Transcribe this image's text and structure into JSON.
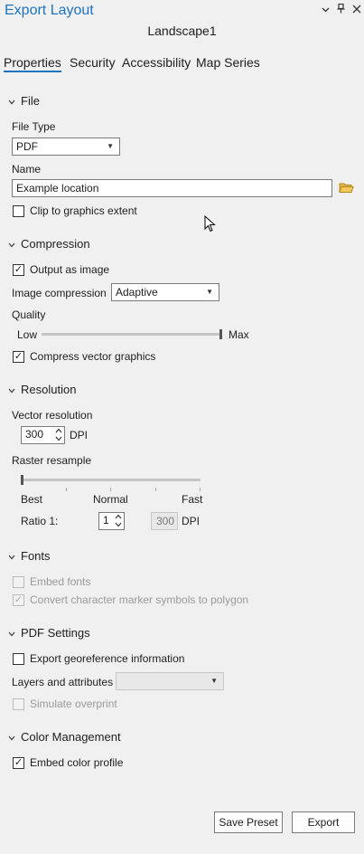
{
  "header": {
    "title": "Export Layout",
    "subtitle": "Landscape1",
    "controls": {
      "menu": "⌄",
      "pin": "📌",
      "close": "✕"
    }
  },
  "tabs": [
    {
      "label": "Properties",
      "active": true
    },
    {
      "label": "Security"
    },
    {
      "label": "Accessibility"
    },
    {
      "label": "Map Series"
    }
  ],
  "file": {
    "heading": "File",
    "file_type_label": "File Type",
    "file_type_value": "PDF",
    "name_label": "Name",
    "name_value": "Example location",
    "clip_label": "Clip to graphics extent",
    "clip_checked": false
  },
  "compression": {
    "heading": "Compression",
    "output_image_label": "Output as image",
    "output_image_checked": true,
    "image_compression_label": "Image compression",
    "image_compression_value": "Adaptive",
    "quality_label": "Quality",
    "quality_min": "Low",
    "quality_max": "Max",
    "quality_level": 1.0,
    "compress_vector_label": "Compress vector graphics",
    "compress_vector_checked": true
  },
  "resolution": {
    "heading": "Resolution",
    "vector_resolution_label": "Vector resolution",
    "vector_resolution_value": "300",
    "dpi_unit": "DPI",
    "raster_resample_label": "Raster resample",
    "resample_best": "Best",
    "resample_normal": "Normal",
    "resample_fast": "Fast",
    "resample_level": 0.0,
    "ratio_label": "Ratio 1:",
    "ratio_value": "1",
    "ratio_dpi_value": "300",
    "ratio_dpi_unit": "DPI"
  },
  "fonts": {
    "heading": "Fonts",
    "embed_fonts_label": "Embed fonts",
    "embed_fonts_checked": false,
    "convert_markers_label": "Convert character marker symbols to polygon",
    "convert_markers_checked": true
  },
  "pdf_settings": {
    "heading": "PDF Settings",
    "georef_label": "Export georeference information",
    "georef_checked": false,
    "layers_label": "Layers and attributes",
    "layers_value": "",
    "overprint_label": "Simulate overprint",
    "overprint_checked": false
  },
  "color_management": {
    "heading": "Color Management",
    "embed_profile_label": "Embed color profile",
    "embed_profile_checked": true
  },
  "footer": {
    "save_preset_label": "Save Preset",
    "export_label": "Export"
  },
  "colors": {
    "accent": "#1e73be",
    "folder": "#d6a21e"
  }
}
